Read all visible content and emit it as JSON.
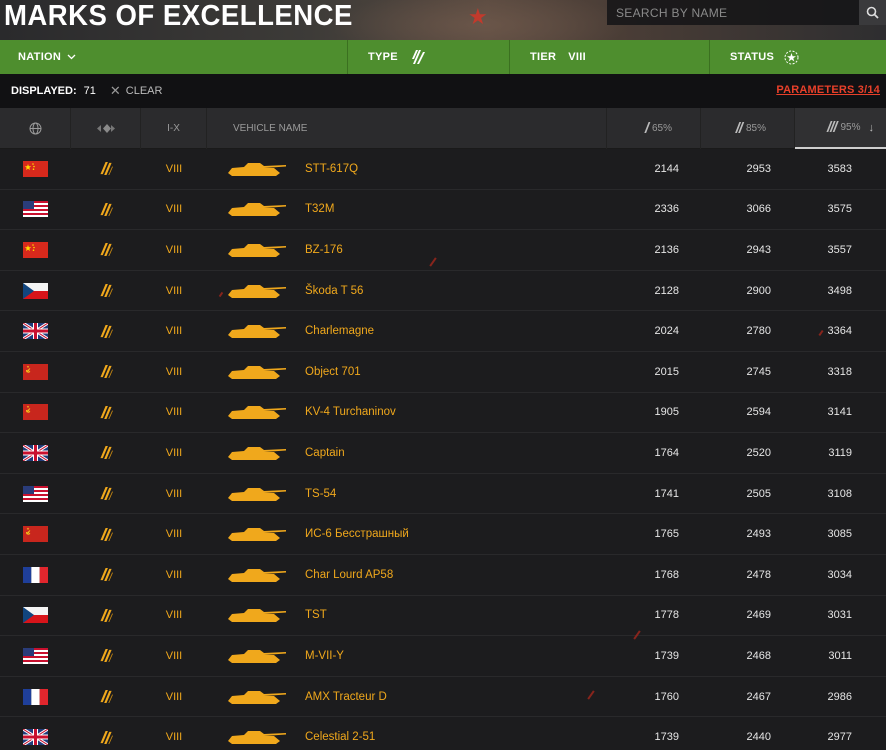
{
  "header": {
    "title": "MARKS OF EXCELLENCE",
    "search_placeholder": "SEARCH BY NAME"
  },
  "filters": {
    "nation_label": "NATION",
    "type_label": "TYPE",
    "tier_label": "TIER",
    "tier_value": "VIII",
    "status_label": "STATUS"
  },
  "summary": {
    "displayed_label": "DISPLAYED:",
    "displayed_count": "71",
    "clear_label": "CLEAR",
    "parameters_label": "PARAMETERS 3/14"
  },
  "columns": {
    "tier": "I-X",
    "name": "VEHICLE NAME",
    "mark1": "65%",
    "mark2": "85%",
    "mark3": "95%"
  },
  "colors": {
    "accent_green": "#4e8e2e",
    "vehicle_gold": "#f0a81c",
    "parameters_red": "#e8402a"
  },
  "rows": [
    {
      "nation": "china",
      "tier": "VIII",
      "name": "STT-617Q",
      "m1": "2144",
      "m2": "2953",
      "m3": "3583"
    },
    {
      "nation": "usa",
      "tier": "VIII",
      "name": "T32M",
      "m1": "2336",
      "m2": "3066",
      "m3": "3575"
    },
    {
      "nation": "china",
      "tier": "VIII",
      "name": "BZ-176",
      "m1": "2136",
      "m2": "2943",
      "m3": "3557"
    },
    {
      "nation": "czech",
      "tier": "VIII",
      "name": "Škoda T 56",
      "m1": "2128",
      "m2": "2900",
      "m3": "3498"
    },
    {
      "nation": "uk",
      "tier": "VIII",
      "name": "Charlemagne",
      "m1": "2024",
      "m2": "2780",
      "m3": "3364"
    },
    {
      "nation": "ussr",
      "tier": "VIII",
      "name": "Object 701",
      "m1": "2015",
      "m2": "2745",
      "m3": "3318"
    },
    {
      "nation": "ussr",
      "tier": "VIII",
      "name": "KV-4 Turchaninov",
      "m1": "1905",
      "m2": "2594",
      "m3": "3141"
    },
    {
      "nation": "uk",
      "tier": "VIII",
      "name": "Captain",
      "m1": "1764",
      "m2": "2520",
      "m3": "3119"
    },
    {
      "nation": "usa",
      "tier": "VIII",
      "name": "TS-54",
      "m1": "1741",
      "m2": "2505",
      "m3": "3108"
    },
    {
      "nation": "ussr",
      "tier": "VIII",
      "name": "ИС-6 Бесстрашный",
      "m1": "1765",
      "m2": "2493",
      "m3": "3085"
    },
    {
      "nation": "france",
      "tier": "VIII",
      "name": "Char Lourd AP58",
      "m1": "1768",
      "m2": "2478",
      "m3": "3034"
    },
    {
      "nation": "czech",
      "tier": "VIII",
      "name": "TST",
      "m1": "1778",
      "m2": "2469",
      "m3": "3031"
    },
    {
      "nation": "usa",
      "tier": "VIII",
      "name": "M-VII-Y",
      "m1": "1739",
      "m2": "2468",
      "m3": "3011"
    },
    {
      "nation": "france",
      "tier": "VIII",
      "name": "AMX Tracteur D",
      "m1": "1760",
      "m2": "2467",
      "m3": "2986"
    },
    {
      "nation": "uk",
      "tier": "VIII",
      "name": "Celestial 2-51",
      "m1": "1739",
      "m2": "2440",
      "m3": "2977"
    }
  ]
}
